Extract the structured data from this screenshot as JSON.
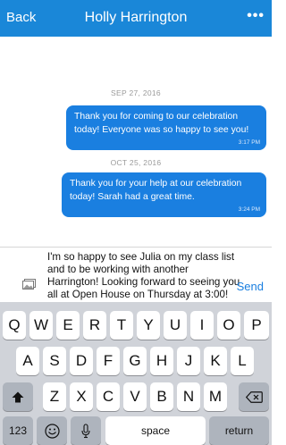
{
  "header": {
    "back_label": "Back",
    "title": "Holly Harrington",
    "more_label": "•••"
  },
  "thread": {
    "groups": [
      {
        "date": "SEP 27, 2016",
        "message": "Thank you for coming to our celebration today! Everyone was so happy to see you!",
        "time": "3:17 PM"
      },
      {
        "date": "OCT 25, 2016",
        "message": "Thank you for your help at our celebration today! Sarah had a great time.",
        "time": "3:24 PM"
      }
    ]
  },
  "compose": {
    "draft": "I'm so happy to see Julia on my class list and to be working with another Harrington! Looking forward to seeing you all at Open House on Thursday at 3:00!",
    "send_label": "Send",
    "attach_icon": "photo-gallery-icon"
  },
  "keyboard": {
    "row1": [
      "Q",
      "W",
      "E",
      "R",
      "T",
      "Y",
      "U",
      "I",
      "O",
      "P"
    ],
    "row2": [
      "A",
      "S",
      "D",
      "F",
      "G",
      "H",
      "J",
      "K",
      "L"
    ],
    "row3": [
      "Z",
      "X",
      "C",
      "V",
      "B",
      "N",
      "M"
    ],
    "shift_icon": "shift-icon",
    "delete_icon": "delete-icon",
    "numbers_label": "123",
    "emoji_icon": "emoji-icon",
    "mic_icon": "microphone-icon",
    "space_label": "space",
    "return_label": "return"
  }
}
